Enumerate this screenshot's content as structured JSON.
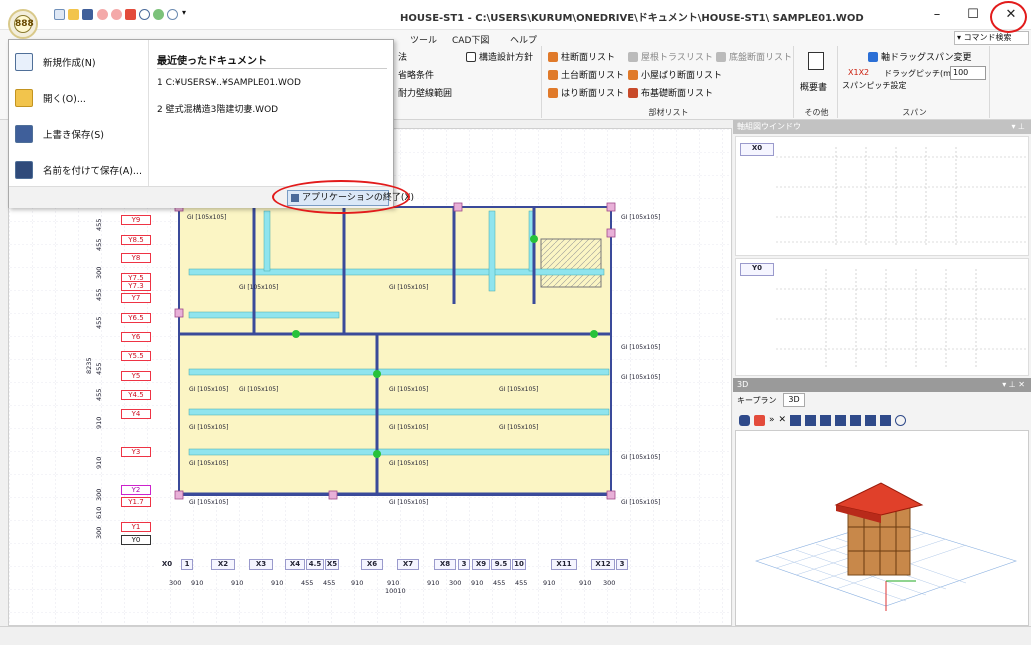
{
  "window": {
    "title": "HOUSE-ST1 - C:\\USERS\\KURUM\\ONEDRIVE\\ドキュメント\\HOUSE-ST1\\ SAMPLE01.WOD",
    "minimize": "–",
    "maximize": "☐",
    "close": "✕"
  },
  "app_button": "888",
  "ribbon": {
    "tabs": [
      "ツール",
      "CAD下図",
      "ヘルプ"
    ],
    "command_search": "コマンド検索",
    "group1_items": [
      "法",
      "省略条件",
      "耐力壁線範囲"
    ],
    "group1_extra": "構造設計方針",
    "group2_items": [
      "柱断面リスト",
      "土台断面リスト",
      "はり断面リスト",
      "屋根トラスリスト",
      "小屋ばり断面リスト",
      "布基礎断面リスト",
      "底盤断面リスト"
    ],
    "group2_label": "部材リスト",
    "group3_item": "概要書",
    "group3_label": "その他",
    "span_check": "軸ドラッグスパン変更",
    "span_pitch_label": "ドラッグピッチ(mm)",
    "span_pitch_value": "100",
    "span_setting": "スパンピッチ設定",
    "span_x": "X1X2",
    "group4_label": "スパン"
  },
  "app_menu": {
    "items": [
      "新規作成(N)",
      "開く(O)...",
      "上書き保存(S)",
      "名前を付けて保存(A)..."
    ],
    "recent_title": "最近使ったドキュメント",
    "recent": [
      "1 C:¥USERS¥..¥SAMPLE01.WOD",
      "2 壁式混構造3階建切妻.WOD"
    ],
    "exit": "アプリケーションの終了(X)"
  },
  "canvas": {
    "y_labels": [
      "Y9",
      "Y8.5",
      "Y8",
      "Y7.5",
      "Y7.3",
      "Y7",
      "Y6.5",
      "Y6",
      "Y5.5",
      "Y5",
      "Y4.5",
      "Y4",
      "Y3",
      "Y2",
      "Y1.7",
      "Y1",
      "Y0"
    ],
    "y_dims": [
      "455",
      "455",
      "300",
      "455",
      "455",
      "455",
      "455",
      "910",
      "910",
      "300",
      "610",
      "300"
    ],
    "y_total": "8235",
    "x_labels": [
      "X0",
      "1",
      "X2",
      "X3",
      "X4",
      "4.5",
      "X5",
      "X6",
      "X7",
      "X8",
      "3",
      "X9",
      "9.5",
      "10",
      "X11",
      "X12",
      "3"
    ],
    "x_dims": [
      "300",
      "910",
      "910",
      "910",
      "455",
      "455",
      "910",
      "910",
      "910",
      "300",
      "910",
      "455",
      "455",
      "910",
      "910",
      "300"
    ],
    "x_total": "10010",
    "beam_label": "GI [105x105]"
  },
  "panels": {
    "axis_window": "軸組図ウインドウ",
    "axis_x": "X0",
    "axis_y": "Y0",
    "view3d_title": "3D",
    "tab_keyplan": "キープラン",
    "tab_3d": "3D",
    "toolbar_icons": [
      "m",
      "», ✕",
      "W",
      "S",
      "C",
      "G",
      "R",
      "B",
      "?",
      "⊖"
    ]
  },
  "colors": {
    "accent": "#e21b1b",
    "floor": "#fbf5c4",
    "beam": "#3a4a9a",
    "cyan_beam": "#8fe4ee"
  }
}
